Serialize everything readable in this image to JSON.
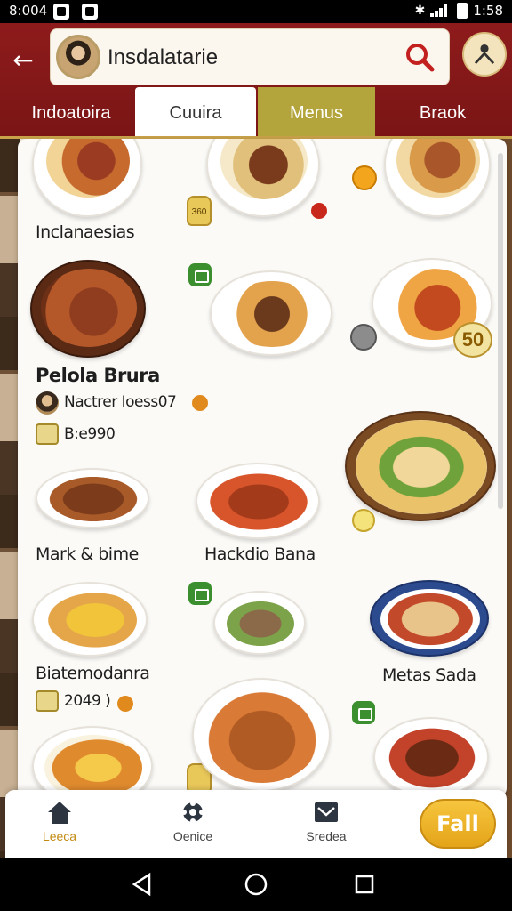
{
  "status_bar": {
    "time": "8:004",
    "time_right": "1:58"
  },
  "header": {
    "search": {
      "value": "Insdalatarie"
    },
    "tabs": [
      {
        "label": "Indoatoira"
      },
      {
        "label": "Cuuira"
      },
      {
        "label": "Menus"
      },
      {
        "label": "Braok"
      }
    ]
  },
  "items": [
    {
      "label": "Inclanaesias"
    },
    {
      "label": "Pelola Brura",
      "subtitle": "Nactrer Ioess07",
      "meta": "B:e990"
    },
    {
      "label": "Mark & bime"
    },
    {
      "label": "Hackdio Bana"
    },
    {
      "label": "Biatemodanra",
      "meta": "2049 )"
    },
    {
      "label": "Metas Sada"
    }
  ],
  "badges": {
    "price_1": "50",
    "bottle_1": "360"
  },
  "bottom_nav": {
    "items": [
      {
        "label": "Leeca",
        "icon": "home-icon"
      },
      {
        "label": "Oenice",
        "icon": "gear-icon"
      },
      {
        "label": "Sredea",
        "icon": "inbox-icon"
      }
    ],
    "fab_label": "Fall"
  },
  "colors": {
    "header": "#8e1b1c",
    "accent": "#e4a419",
    "tab_menus": "#b3a53b"
  }
}
